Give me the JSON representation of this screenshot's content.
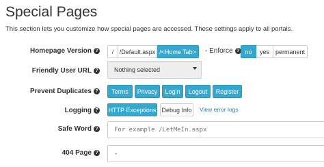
{
  "page": {
    "title": "Special Pages",
    "description": "This section lets you customize how special pages are accessed. These settings apply to all portals."
  },
  "icons": {
    "help": "question-circle-icon",
    "dropdown": "caret-down-icon"
  },
  "colors": {
    "primary": "#35a8d0",
    "link": "#337ab7"
  },
  "homepage": {
    "label": "Homepage Version",
    "options": [
      "/",
      "/Default.aspx",
      "/<Home Tab>"
    ],
    "selected": "/<Home Tab>",
    "enforce_label": "- Enforce",
    "enforce_options": [
      "no",
      "yes",
      "permanent"
    ],
    "enforce_selected": "no"
  },
  "friendly_url": {
    "label": "Friendly User URL",
    "value": "Nothing selected"
  },
  "prevent_duplicates": {
    "label": "Prevent Duplicates",
    "buttons": [
      "Terms",
      "Privacy",
      "Login",
      "Logout",
      "Register"
    ]
  },
  "logging": {
    "label": "Logging",
    "options": [
      "HTTP Exceptions",
      "Debug Info"
    ],
    "selected": "HTTP Exceptions",
    "link": "View error logs"
  },
  "safe_word": {
    "label": "Safe Word",
    "placeholder": "For example /LetMeIn.aspx",
    "value": ""
  },
  "page_404": {
    "label": "404 Page",
    "value": "-"
  }
}
